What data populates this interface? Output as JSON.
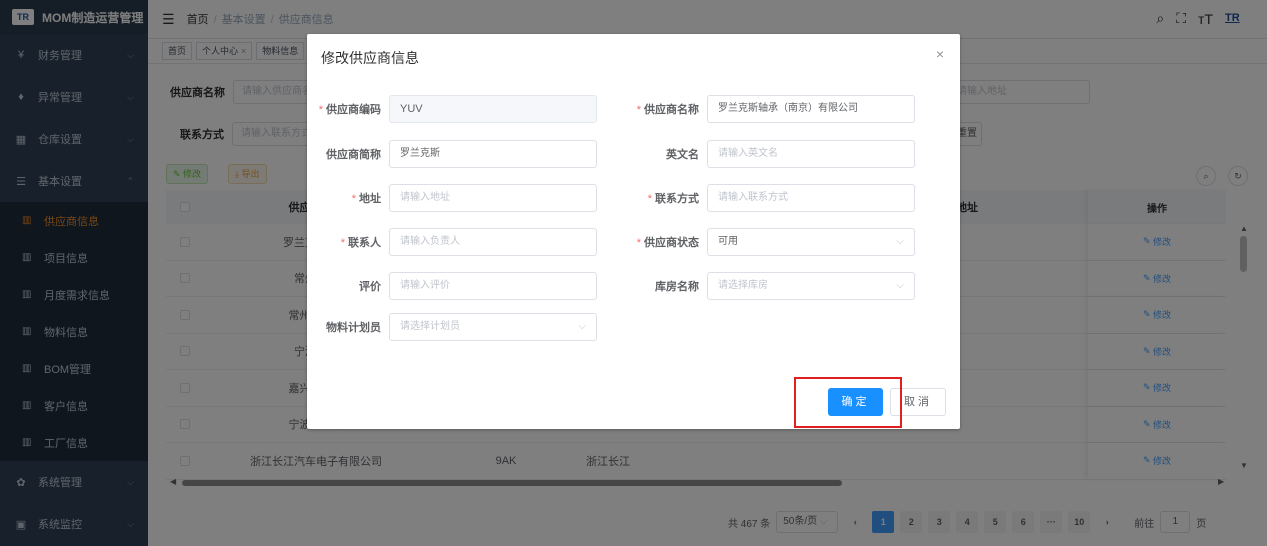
{
  "app": {
    "logo_text": "TR",
    "title": "MOM制造运营管理"
  },
  "sidebar": {
    "items": [
      {
        "label": "财务管理",
        "icon": "¥"
      },
      {
        "label": "异常管理",
        "icon": "♦"
      },
      {
        "label": "仓库设置",
        "icon": "▦"
      },
      {
        "label": "基本设置",
        "icon": "☰"
      }
    ],
    "sub_items": [
      {
        "label": "供应商信息"
      },
      {
        "label": "项目信息"
      },
      {
        "label": "月度需求信息"
      },
      {
        "label": "物料信息"
      },
      {
        "label": "BOM管理"
      },
      {
        "label": "客户信息"
      },
      {
        "label": "工厂信息"
      }
    ],
    "bottom_items": [
      {
        "label": "系统管理",
        "icon": "✿"
      },
      {
        "label": "系统监控",
        "icon": "▣"
      }
    ]
  },
  "header": {
    "crumb_home": "首页",
    "crumb_1": "基本设置",
    "crumb_2": "供应商信息",
    "avatar_text": "TR"
  },
  "tags": [
    {
      "label": "首页"
    },
    {
      "label": "个人中心"
    },
    {
      "label": "物料信息"
    }
  ],
  "search": {
    "name_label": "供应商名称",
    "name_placeholder": "请输入供应商名称",
    "contact_label": "联系方式",
    "contact_placeholder": "请输入联系方式",
    "addr_placeholder": "请输入地址",
    "reset_label": "重置"
  },
  "toolbar": {
    "edit_label": "修改",
    "export_label": "导出"
  },
  "table": {
    "col_name": "供应商名称",
    "col_addr": "地址",
    "col_op": "操作",
    "row_op_label": "修改",
    "rows": [
      {
        "name": "罗兰克斯轴承",
        "code": "",
        "addr": ""
      },
      {
        "name": "常州润优",
        "code": "",
        "addr": ""
      },
      {
        "name": "常州市跃进",
        "code": "",
        "addr": ""
      },
      {
        "name": "宁波润楠",
        "code": "",
        "addr": ""
      },
      {
        "name": "嘉兴东飞佳",
        "code": "",
        "addr": ""
      },
      {
        "name": "宁波理想汽",
        "code": "",
        "addr": ""
      },
      {
        "name": "浙江长江汽车电子有限公司",
        "code": "9AK",
        "addr": "浙江长江"
      }
    ]
  },
  "pager": {
    "total": "共 467 条",
    "size": "50条/页",
    "pages": [
      "1",
      "2",
      "3",
      "4",
      "5",
      "6",
      "···",
      "10"
    ],
    "goto_label": "前往",
    "goto_value": "1",
    "page_unit": "页"
  },
  "dialog": {
    "title": "修改供应商信息",
    "fields": {
      "code": {
        "label": "供应商编码",
        "value": "YUV"
      },
      "name": {
        "label": "供应商名称",
        "value": "罗兰克斯轴承（南京）有限公司"
      },
      "short": {
        "label": "供应商简称",
        "value": "罗兰克斯"
      },
      "en": {
        "label": "英文名",
        "placeholder": "请输入英文名"
      },
      "addr": {
        "label": "地址",
        "placeholder": "请输入地址"
      },
      "contact": {
        "label": "联系方式",
        "placeholder": "请输入联系方式"
      },
      "person": {
        "label": "联系人",
        "placeholder": "请输入负责人"
      },
      "status": {
        "label": "供应商状态",
        "value": "可用"
      },
      "rating": {
        "label": "评价",
        "placeholder": "请输入评价"
      },
      "warehouse": {
        "label": "库房名称",
        "placeholder": "请选择库房"
      },
      "planner": {
        "label": "物料计划员",
        "placeholder": "请选择计划员"
      }
    },
    "confirm_label": "确定",
    "cancel_label": "取消"
  },
  "colors": {
    "primary": "#1890ff",
    "highlight": "#e02020",
    "active_menu": "#f08c2b"
  }
}
